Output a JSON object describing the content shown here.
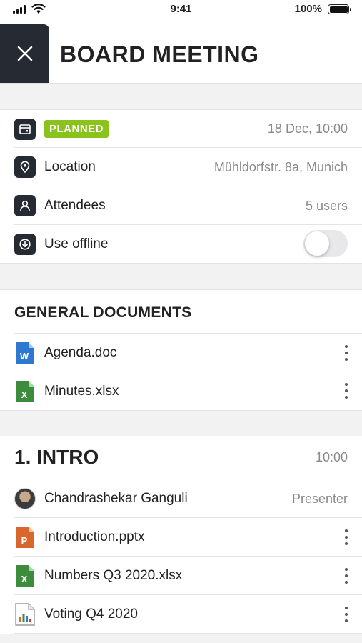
{
  "status_bar": {
    "time": "9:41",
    "battery": "100%"
  },
  "header": {
    "title": "BOARD MEETING"
  },
  "meeting": {
    "status_badge": "PLANNED",
    "datetime": "18 Dec, 10:00",
    "location_label": "Location",
    "location_value": "Mühldorfstr. 8a, Munich",
    "attendees_label": "Attendees",
    "attendees_value": "5 users",
    "offline_label": "Use offline",
    "offline_enabled": false
  },
  "general_documents": {
    "title": "GENERAL DOCUMENTS",
    "items": [
      {
        "name": "Agenda.doc",
        "type": "word"
      },
      {
        "name": "Minutes.xlsx",
        "type": "excel"
      }
    ]
  },
  "agenda_item": {
    "title": "1. INTRO",
    "time": "10:00",
    "presenter_name": "Chandrashekar Ganguli",
    "presenter_role": "Presenter",
    "items": [
      {
        "name": "Introduction.pptx",
        "type": "powerpoint"
      },
      {
        "name": "Numbers Q3 2020.xlsx",
        "type": "excel"
      },
      {
        "name": "Voting Q4 2020",
        "type": "voting"
      }
    ]
  },
  "colors": {
    "badge": "#8bc31d",
    "dark": "#262a33",
    "word": "#2f78d0",
    "excel": "#3d8c3d",
    "powerpoint": "#d8662d"
  }
}
